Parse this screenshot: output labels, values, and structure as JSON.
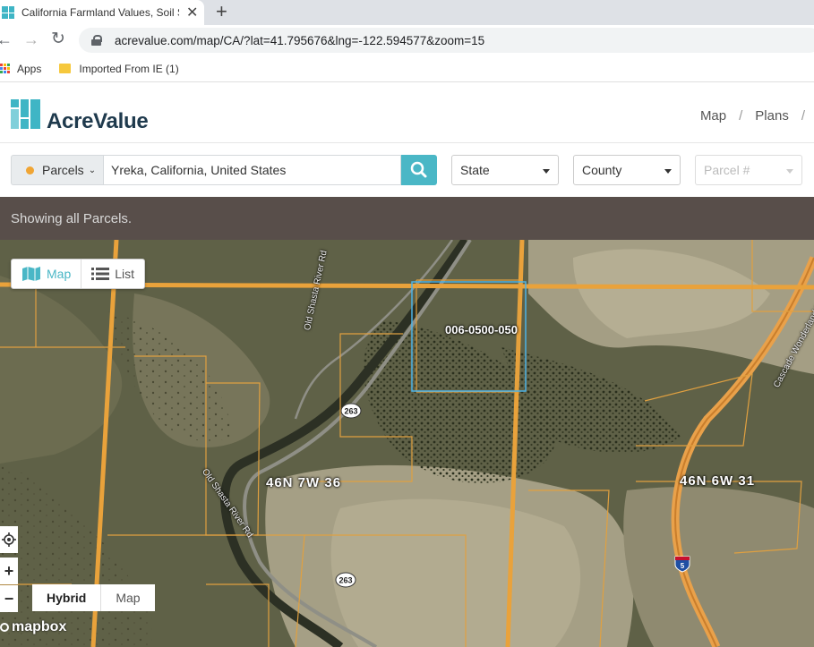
{
  "browser": {
    "tab_title": "California Farmland Values, Soil S",
    "close_glyph": "✕",
    "new_tab_glyph": "+",
    "back_glyph": "←",
    "forward_glyph": "→",
    "reload_glyph": "↻",
    "url": "acrevalue.com/map/CA/?lat=41.795676&lng=-122.594577&zoom=15",
    "bookmarks": {
      "apps": "Apps",
      "imported": "Imported From IE (1)"
    }
  },
  "site": {
    "logo_text": "AcreValue",
    "nav": [
      {
        "label": "Map"
      },
      {
        "label": "Plans"
      }
    ],
    "nav_separator": "/",
    "brand_color": "#4ab7c6"
  },
  "search": {
    "parcels_label": "Parcels",
    "chevron": "⌄",
    "query": "Yreka, California, United States",
    "state_label": "State",
    "county_label": "County",
    "parcel_placeholder": "Parcel #"
  },
  "banner": {
    "text": "Showing all Parcels."
  },
  "map": {
    "view_toggle": {
      "map": "Map",
      "list": "List"
    },
    "labels": {
      "parcel_id": "006-0500-050",
      "section_west": "46N 7W 36",
      "section_east": "46N 6W 31",
      "road_old_shasta_top": "Old Shasta River Rd",
      "road_old_shasta_bottom": "Old Shasta River Rd",
      "road_cascade": "Cascade Wonderland Hwy",
      "shield_263_a": "263",
      "shield_263_b": "263",
      "shield_i5": "5"
    },
    "controls": {
      "zoom_in": "+",
      "zoom_out": "−"
    },
    "basemap": {
      "hybrid": "Hybrid",
      "map": "Map"
    },
    "attribution": "mapbox"
  }
}
